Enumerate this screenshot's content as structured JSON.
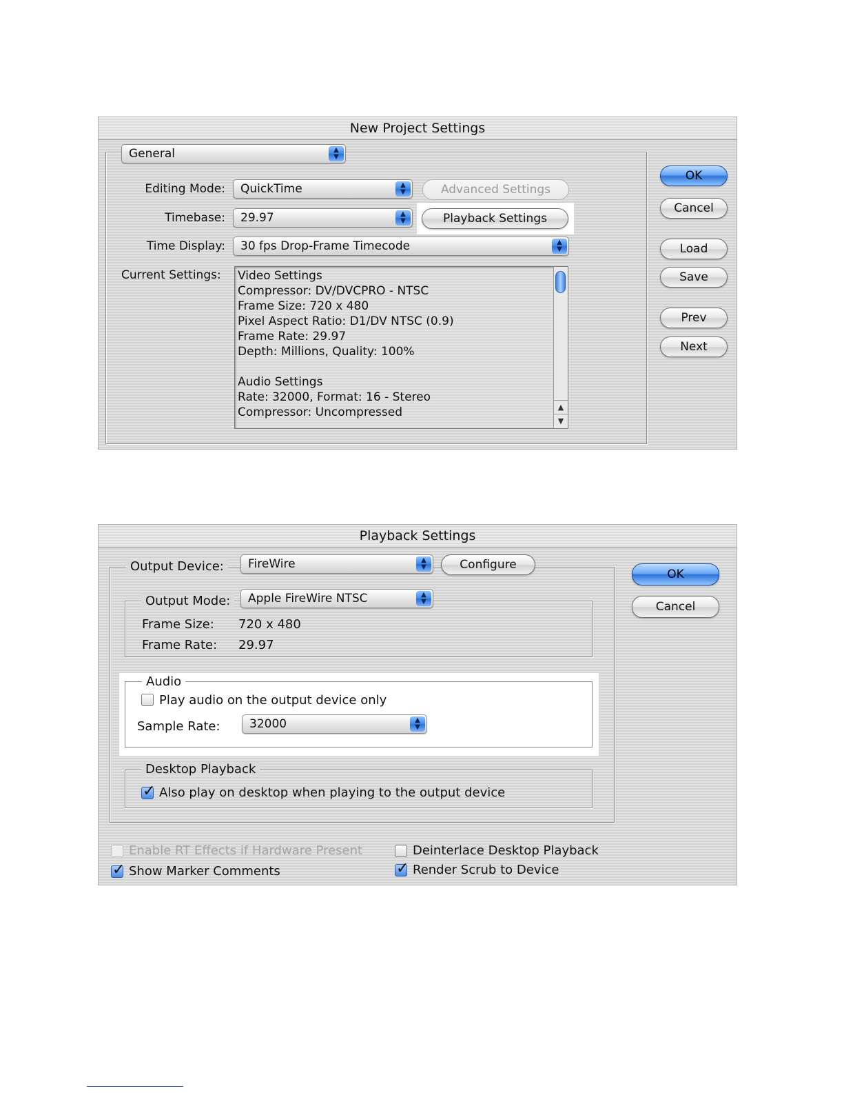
{
  "new_project": {
    "title": "New Project Settings",
    "section_popup": "General",
    "editing_mode_label": "Editing Mode:",
    "editing_mode_value": "QuickTime",
    "timebase_label": "Timebase:",
    "timebase_value": "29.97",
    "time_display_label": "Time Display:",
    "time_display_value": "30 fps Drop-Frame Timecode",
    "current_settings_label": "Current Settings:",
    "advanced_settings_button": "Advanced Settings",
    "playback_settings_button": "Playback Settings",
    "current_settings_lines": [
      "Video Settings",
      "Compressor: DV/DVCPRO - NTSC",
      "Frame Size: 720 x 480",
      "Pixel Aspect Ratio: D1/DV NTSC (0.9)",
      "Frame Rate: 29.97",
      "Depth: Millions, Quality: 100%",
      "",
      "Audio Settings",
      "Rate: 32000, Format: 16 - Stereo",
      "Compressor: Uncompressed"
    ],
    "buttons": {
      "ok": "OK",
      "cancel": "Cancel",
      "load": "Load",
      "save": "Save",
      "prev": "Prev",
      "next": "Next"
    }
  },
  "playback": {
    "title": "Playback Settings",
    "output_device_label": "Output Device:",
    "output_device_value": "FireWire",
    "configure_button": "Configure",
    "output_mode_label": "Output Mode:",
    "output_mode_value": "Apple FireWire NTSC",
    "frame_size_label": "Frame Size:",
    "frame_size_value": "720 x 480",
    "frame_rate_label": "Frame Rate:",
    "frame_rate_value": "29.97",
    "audio_legend": "Audio",
    "play_audio_label": "Play audio on the output device only",
    "play_audio_checked": false,
    "sample_rate_label": "Sample Rate:",
    "sample_rate_value": "32000",
    "desktop_legend": "Desktop Playback",
    "also_play_label": "Also play on desktop when playing to the output device",
    "also_play_checked": true,
    "enable_rt_label": "Enable RT Effects if Hardware Present",
    "show_marker_label": "Show Marker Comments",
    "deinterlace_label": "Deinterlace Desktop Playback",
    "render_scrub_label": "Render Scrub to Device",
    "buttons": {
      "ok": "OK",
      "cancel": "Cancel"
    }
  },
  "colors": {
    "accent_blue": "#3d86ea",
    "window_stripe_light": "#e2e2e2",
    "window_stripe_dark": "#d2d2d2",
    "highlight": "#ffffff"
  }
}
